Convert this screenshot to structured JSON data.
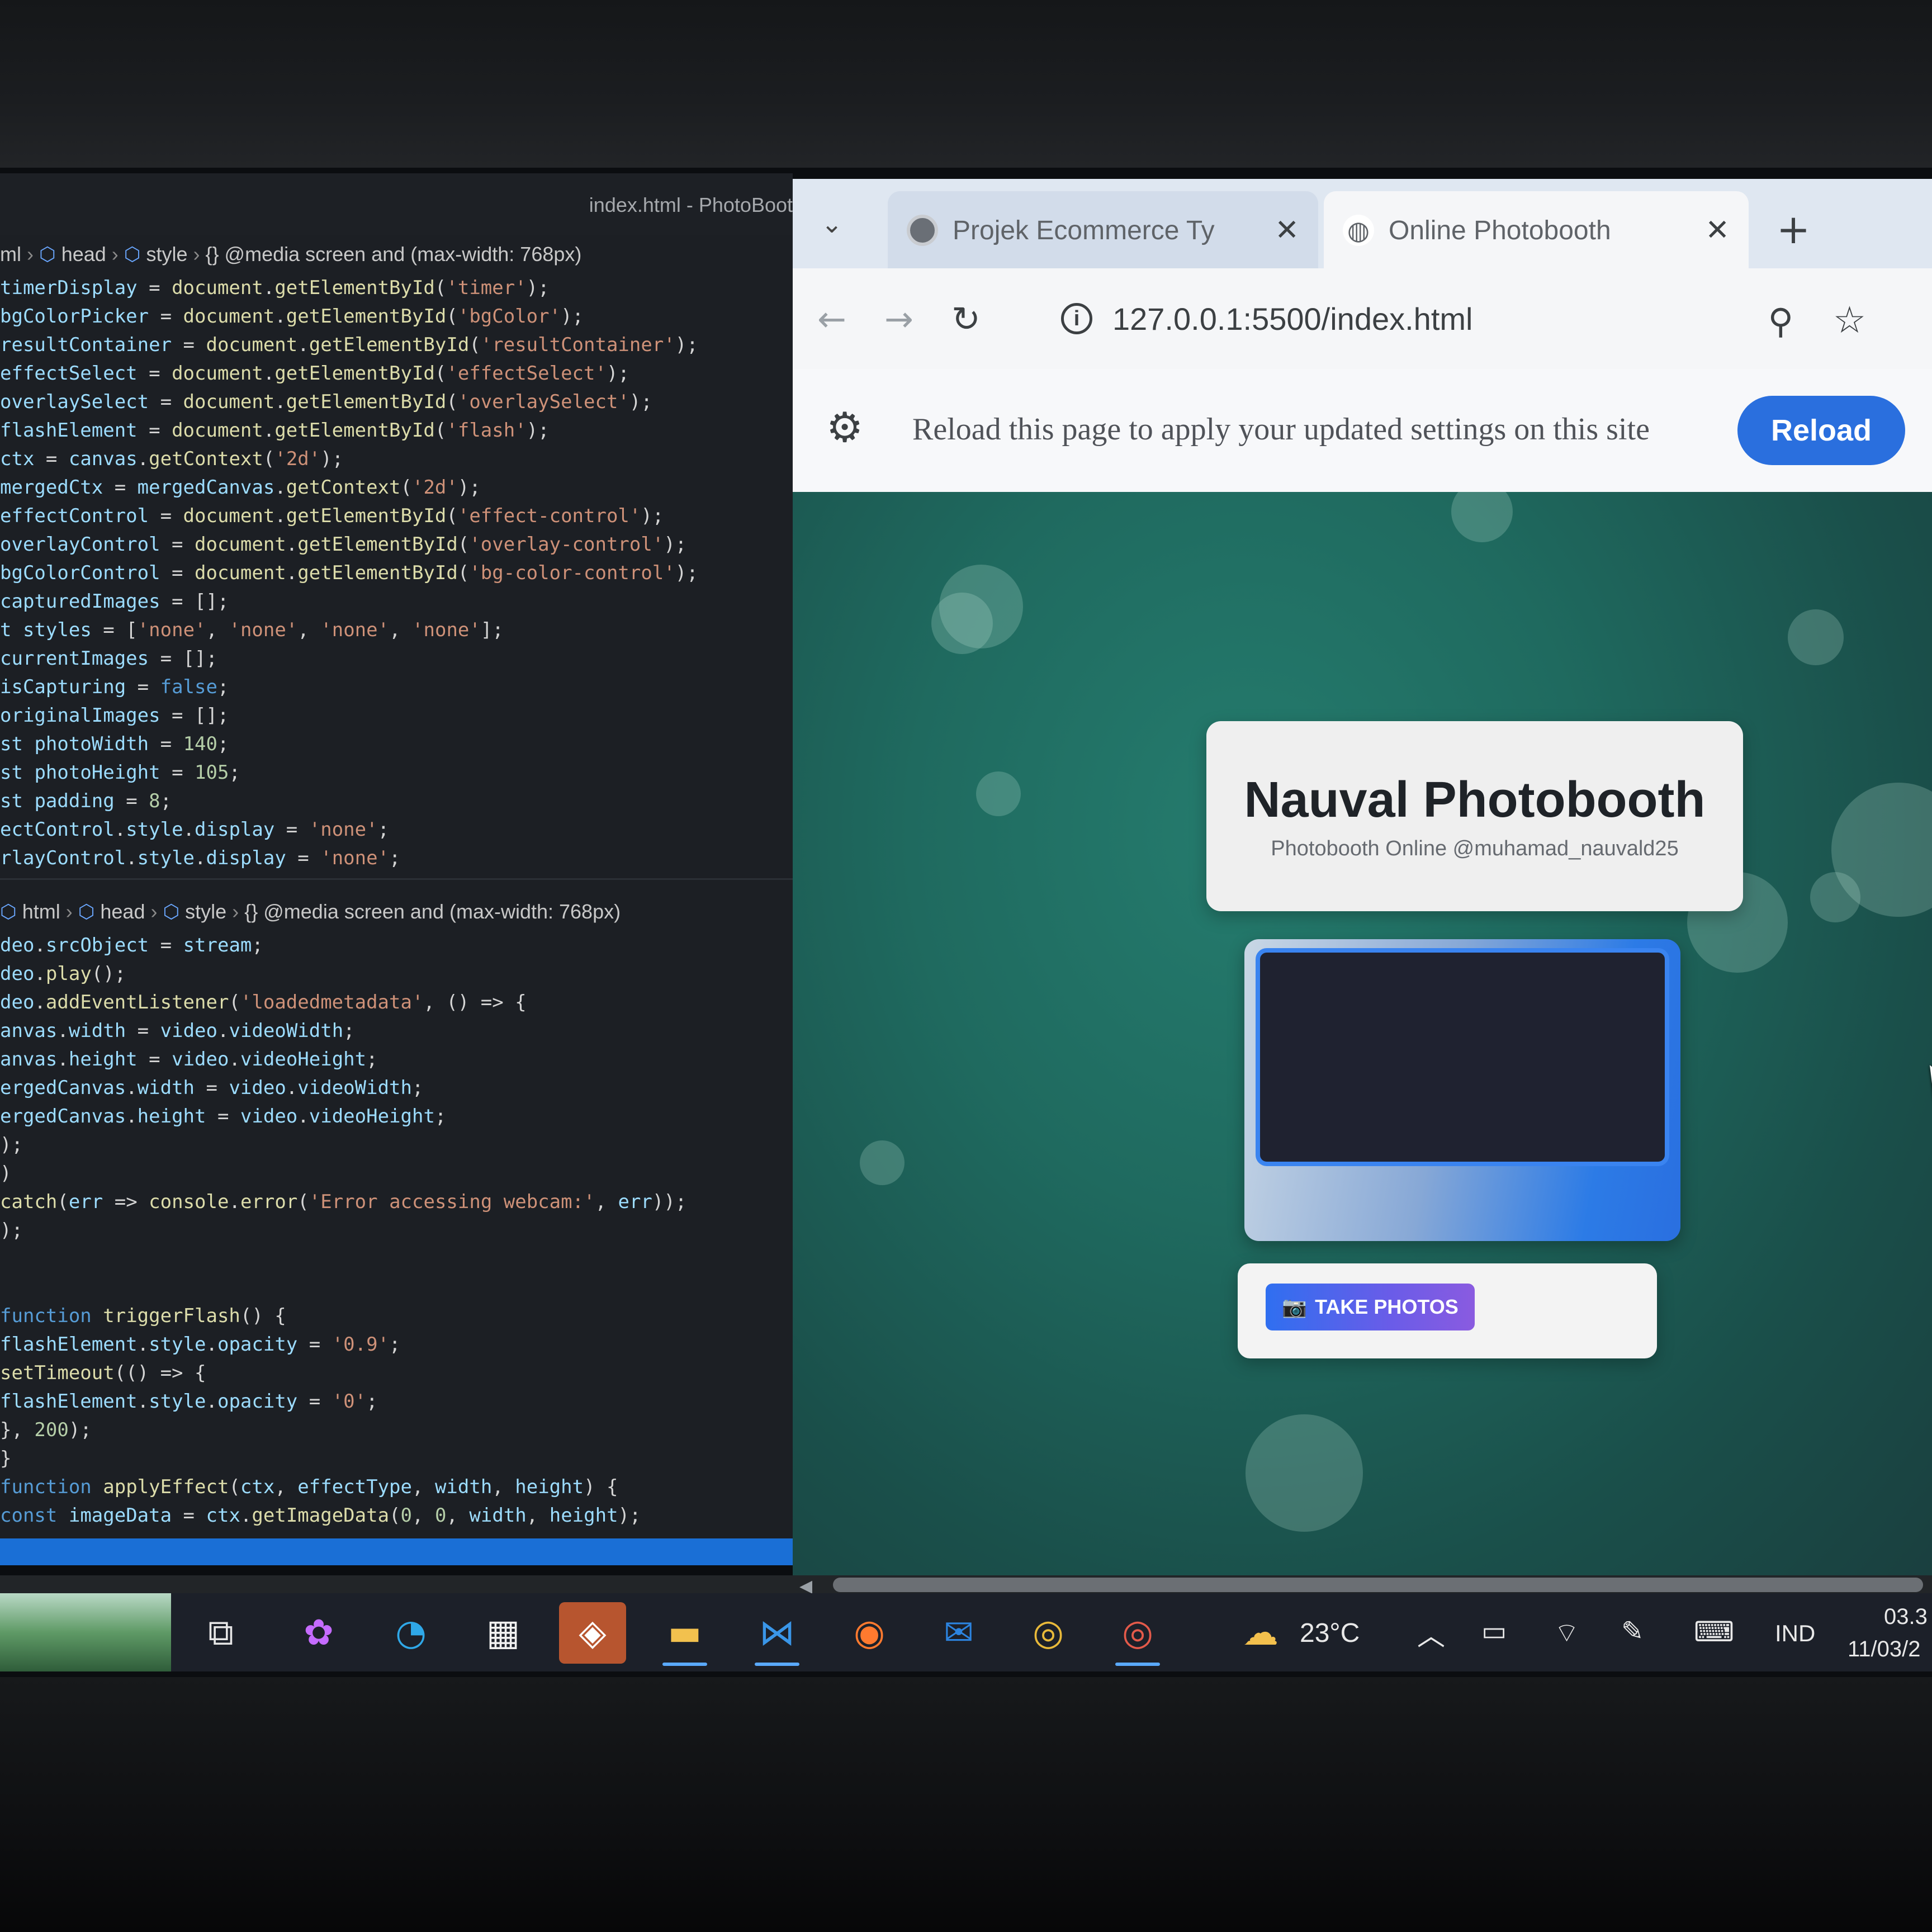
{
  "editor": {
    "title": "index.html - PhotoBoot",
    "breadcrumb_top": [
      "ml",
      "head",
      "style",
      "@media screen and (max-width: 768px)"
    ],
    "breadcrumb_bottom": [
      "html",
      "head",
      "style",
      "@media screen and (max-width: 768px)"
    ],
    "code_top": [
      "timerDisplay = document.getElementById('timer');",
      "bgColorPicker = document.getElementById('bgColor');",
      "resultContainer = document.getElementById('resultContainer');",
      "effectSelect = document.getElementById('effectSelect');",
      "overlaySelect = document.getElementById('overlaySelect');",
      "flashElement = document.getElementById('flash');",
      "ctx = canvas.getContext('2d');",
      "mergedCtx = mergedCanvas.getContext('2d');",
      "effectControl = document.getElementById('effect-control');",
      "overlayControl = document.getElementById('overlay-control');",
      "bgColorControl = document.getElementById('bg-color-control');",
      "capturedImages = [];",
      "t styles = ['none', 'none', 'none', 'none'];",
      "currentImages = [];",
      "isCapturing = false;",
      "originalImages = [];",
      "st photoWidth = 140;",
      "st photoHeight = 105;",
      "st padding = 8;",
      "ectControl.style.display = 'none';",
      "rlayControl.style.display = 'none';"
    ],
    "code_bottom": [
      "deo.srcObject = stream;",
      "deo.play();",
      "deo.addEventListener('loadedmetadata', () => {",
      "anvas.width = video.videoWidth;",
      "anvas.height = video.videoHeight;",
      "ergedCanvas.width = video.videoWidth;",
      "ergedCanvas.height = video.videoHeight;",
      ");",
      ")",
      "catch(err => console.error('Error accessing webcam:', err));",
      ");",
      "",
      "",
      "function triggerFlash() {",
      "flashElement.style.opacity = '0.9';",
      "setTimeout(() => {",
      "flashElement.style.opacity = '0';",
      "}, 200);",
      "}",
      "function applyEffect(ctx, effectType, width, height) {",
      "const imageData = ctx.getImageData(0, 0, width, height);"
    ]
  },
  "browser": {
    "tabs": [
      {
        "title": "Projek Ecommerce Ty",
        "close": "✕",
        "active": false
      },
      {
        "title": "Online Photobooth",
        "close": "✕",
        "active": true
      }
    ],
    "new_tab": "+",
    "url": "127.0.0.1:5500/index.html",
    "infobar_text": "Reload this page to apply your updated settings on this site",
    "reload_label": "Reload"
  },
  "page": {
    "title": "Nauval Photobooth",
    "subtitle": "Photobooth Online @muhamad_nauvald25",
    "take_photos_label": "TAKE PHOTOS"
  },
  "taskbar": {
    "temperature": "23°C",
    "language": "IND",
    "time": "03.3",
    "date": "11/03/2"
  },
  "colors": {
    "accent": "#2a6fde",
    "page_bg": "#1f6a5f",
    "editor_bg": "#1c1f24"
  }
}
